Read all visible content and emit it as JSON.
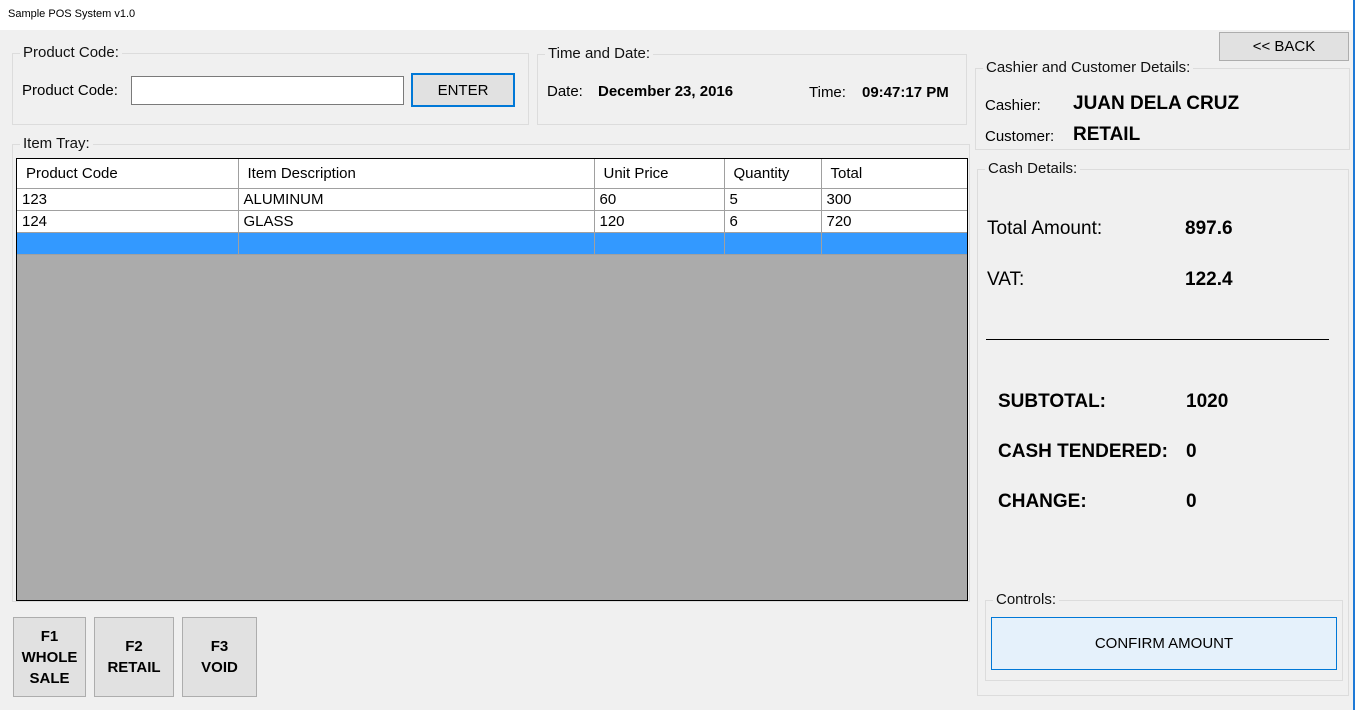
{
  "window": {
    "title": "Sample POS System v1.0"
  },
  "product_code": {
    "group_label": "Product Code:",
    "field_label": "Product Code:",
    "input_value": "",
    "enter_label": "ENTER"
  },
  "time_date": {
    "group_label": "Time and Date:",
    "date_label": "Date:",
    "date_value": "December 23, 2016",
    "time_label": "Time:",
    "time_value": "09:47:17 PM"
  },
  "back_label": "<< BACK",
  "cashier_customer": {
    "group_label": "Cashier and Customer Details:",
    "cashier_label": "Cashier:",
    "cashier_value": "JUAN DELA CRUZ",
    "customer_label": "Customer:",
    "customer_value": "RETAIL"
  },
  "cash_details": {
    "group_label": "Cash Details:",
    "total_amount_label": "Total Amount:",
    "total_amount_value": "897.6",
    "vat_label": "VAT:",
    "vat_value": "122.4",
    "subtotal_label": "SUBTOTAL:",
    "subtotal_value": "1020",
    "cash_tendered_label": "CASH TENDERED:",
    "cash_tendered_value": "0",
    "change_label": "CHANGE:",
    "change_value": "0"
  },
  "controls": {
    "group_label": "Controls:",
    "confirm_label": "CONFIRM AMOUNT"
  },
  "item_tray": {
    "group_label": "Item Tray:",
    "columns": [
      "Product Code",
      "Item Description",
      "Unit Price",
      "Quantity",
      "Total"
    ],
    "rows": [
      [
        "123",
        "ALUMINUM",
        "60",
        "5",
        "300"
      ],
      [
        "124",
        "GLASS",
        "120",
        "6",
        "720"
      ]
    ],
    "selection_color": "#3399ff"
  },
  "function_keys": [
    {
      "key": "F1",
      "line1": "WHOLE",
      "line2": "SALE"
    },
    {
      "key": "F2",
      "line1": "RETAIL",
      "line2": ""
    },
    {
      "key": "F3",
      "line1": "VOID",
      "line2": ""
    }
  ]
}
